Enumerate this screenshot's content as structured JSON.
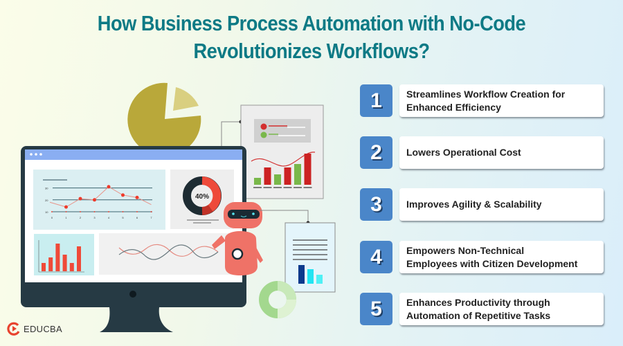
{
  "title": {
    "line1": "How Business Process Automation with No-Code",
    "line2": "Revolutionizes Workflows?"
  },
  "colors": {
    "title": "#0e7a85",
    "number_badge": "#4a86c9",
    "monitor_frame": "#263a44",
    "monitor_header": "#8aaef2",
    "accent_red": "#e84c3d",
    "robot": "#ef7267",
    "pie": "#b9a83a",
    "pie_slice": "#d9cf80"
  },
  "items": [
    {
      "number": "1",
      "text_line1": "Streamlines Workflow Creation for",
      "text_line2": "Enhanced Efficiency"
    },
    {
      "number": "2",
      "text_line1": "Lowers Operational Cost",
      "text_line2": ""
    },
    {
      "number": "3",
      "text_line1": "Improves Agility & Scalability",
      "text_line2": ""
    },
    {
      "number": "4",
      "text_line1": "Empowers Non-Technical",
      "text_line2": "Employees with Citizen Development"
    },
    {
      "number": "5",
      "text_line1": "Enhances Productivity through",
      "text_line2": "Automation of Repetitive Tasks"
    }
  ],
  "illustration": {
    "donut_label": "40%",
    "donut_value_percent": 40,
    "line_chart": {
      "y_ticks": [
        "30",
        "20",
        "10"
      ],
      "x_ticks": [
        "0",
        "1",
        "2",
        "3",
        "4",
        "5",
        "6",
        "7"
      ],
      "points": [
        [
          1,
          14
        ],
        [
          2,
          21
        ],
        [
          3,
          20
        ],
        [
          4,
          31
        ],
        [
          5,
          24
        ],
        [
          6,
          22
        ]
      ]
    },
    "bar_chart_values": [
      3,
      5,
      10,
      6,
      3,
      9
    ],
    "report_bar_values": [
      2,
      5,
      3,
      5,
      6,
      9
    ]
  },
  "logo": {
    "text": "EDUCBA",
    "icon": "educba-logo-icon"
  }
}
